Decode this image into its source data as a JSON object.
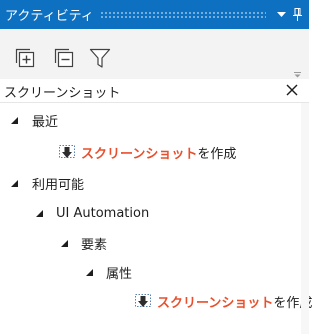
{
  "panel": {
    "title": "アクティビティ",
    "search_text": "スクリーンショット",
    "title_icons": [
      "dropdown-arrow-icon",
      "pin-icon"
    ],
    "toolbar_icons": [
      "expand-all-icon",
      "collapse-all-icon",
      "filter-icon"
    ]
  },
  "tree": {
    "recent": {
      "label": "最近",
      "activity": {
        "highlight": "スクリーンショット",
        "rest": "を作成"
      }
    },
    "available": {
      "label": "利用可能",
      "ui_automation": {
        "label": "UI Automation",
        "elements": {
          "label": "要素",
          "attributes": {
            "label": "属性",
            "activity": {
              "highlight": "スクリーンショット",
              "rest": "を作成"
            }
          }
        }
      }
    }
  },
  "colors": {
    "titlebar": "#0e70c0",
    "toolbar": "#f3f3f3",
    "highlight": "#e8502d"
  }
}
